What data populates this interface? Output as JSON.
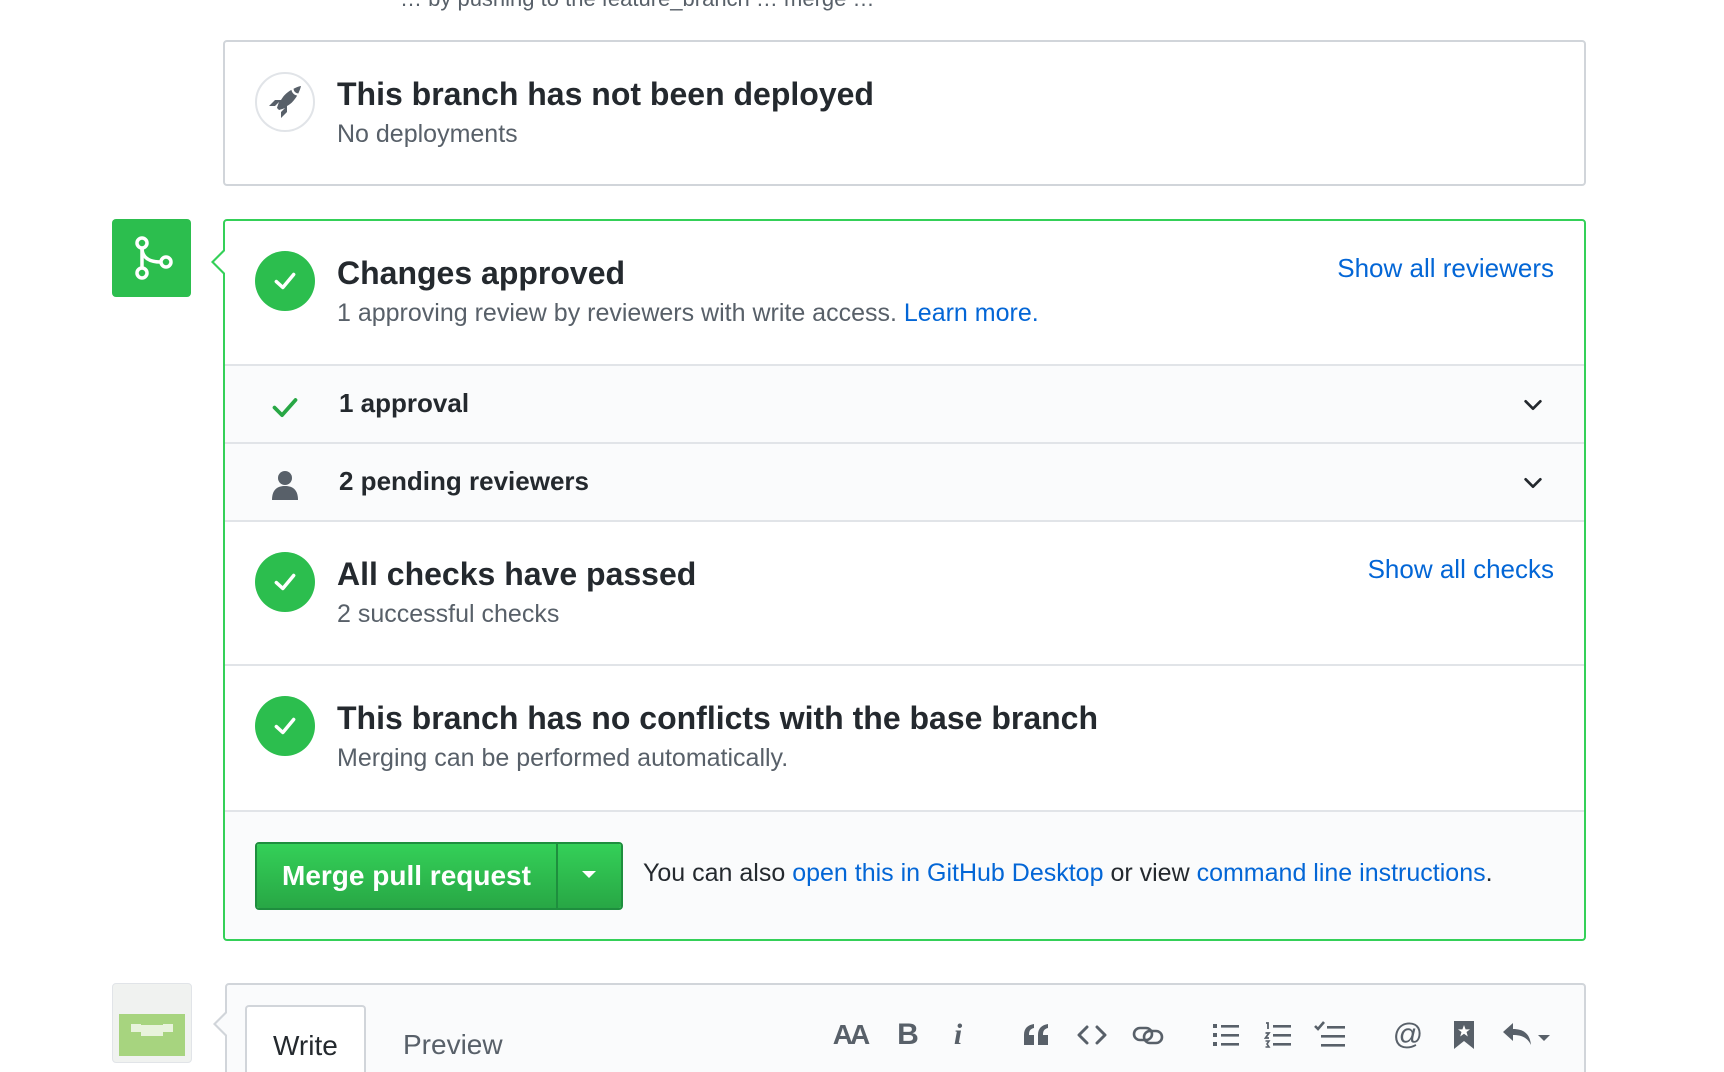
{
  "page_cut_text": "… by pushing to the feature_branch … merge …",
  "deployment": {
    "title": "This branch has not been deployed",
    "subtitle": "No deployments"
  },
  "review": {
    "title": "Changes approved",
    "subtitle": "1 approving review by reviewers with write access.",
    "learn_more": "Learn more.",
    "show_reviewers": "Show all reviewers",
    "approvals_label": "1 approval",
    "pending_label": "2 pending reviewers"
  },
  "checks": {
    "title": "All checks have passed",
    "subtitle": "2 successful checks",
    "show_checks": "Show all checks"
  },
  "conflicts": {
    "title": "This branch has no conflicts with the base branch",
    "subtitle": "Merging can be performed automatically."
  },
  "actions": {
    "merge_button": "Merge pull request",
    "text_prefix": "You can also",
    "desktop_link": "open this in GitHub Desktop",
    "text_mid": "or view",
    "cli_link": "command line instructions",
    "text_suffix": "."
  },
  "comment": {
    "tab_write": "Write",
    "tab_preview": "Preview",
    "toolbar": [
      "header-icon",
      "bold-icon",
      "italic-icon",
      "quote-icon",
      "code-icon",
      "link-icon",
      "unordered-list-icon",
      "ordered-list-icon",
      "task-list-icon",
      "mention-icon",
      "saved-reply-icon",
      "reply-icon"
    ],
    "header_glyph": "AA",
    "bold_glyph": "B",
    "italic_glyph": "i",
    "mention_glyph": "@"
  },
  "colors": {
    "success": "#2cbe4e",
    "link": "#0366d6",
    "border_green": "#34d058"
  }
}
